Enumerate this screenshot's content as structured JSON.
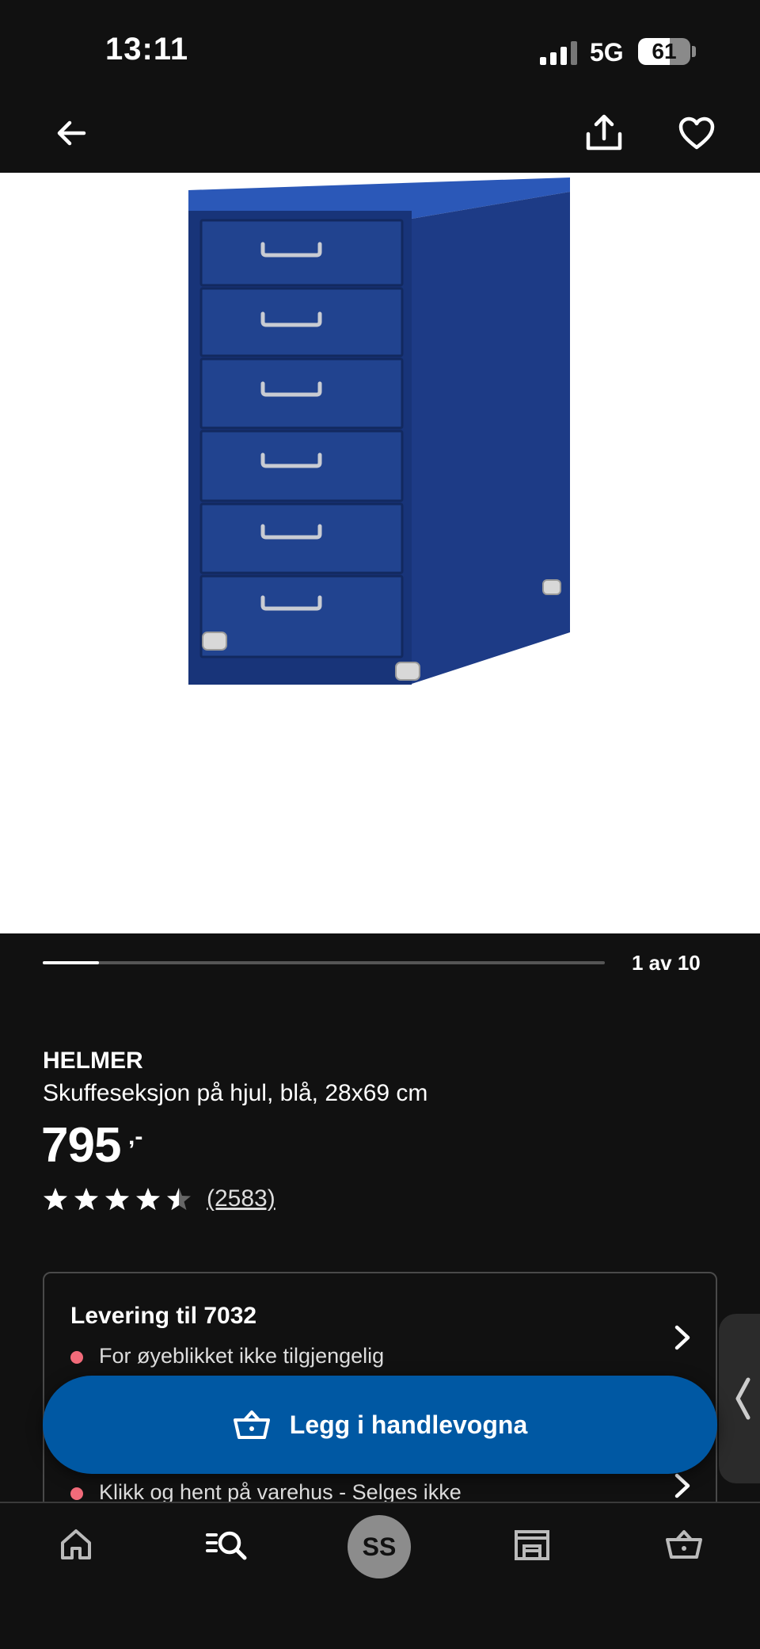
{
  "status_bar": {
    "time": "13:11",
    "network": "5G",
    "battery": "61",
    "battery_level": 0.61
  },
  "nav": {
    "back_icon": "arrow-left-icon",
    "share_icon": "share-icon",
    "favorite_icon": "heart-icon"
  },
  "gallery": {
    "counter": "1 av 10",
    "progress": 0.1
  },
  "product": {
    "name": "HELMER",
    "description": "Skuffeseksjon på hjul, blå, 28x69 cm",
    "price": "795",
    "price_suffix": ",-",
    "rating": 4.5,
    "review_count": "(2583)"
  },
  "delivery": {
    "title": "Levering til 7032",
    "status": "For øyeblikket ikke tilgjengelig",
    "store_status": "Klikk og hent på varehus - Selges ikke"
  },
  "cart_button": {
    "label": "Legg i handlevogna"
  },
  "tab_bar": {
    "items": [
      "home-icon",
      "search-list-icon",
      "profile-avatar",
      "store-icon",
      "cart-icon"
    ],
    "avatar_initials": "SS"
  },
  "colors": {
    "background": "#111111",
    "accent": "#0058a3",
    "status_dot": "#f26b7a",
    "product_blue": "#1f3f8f"
  }
}
